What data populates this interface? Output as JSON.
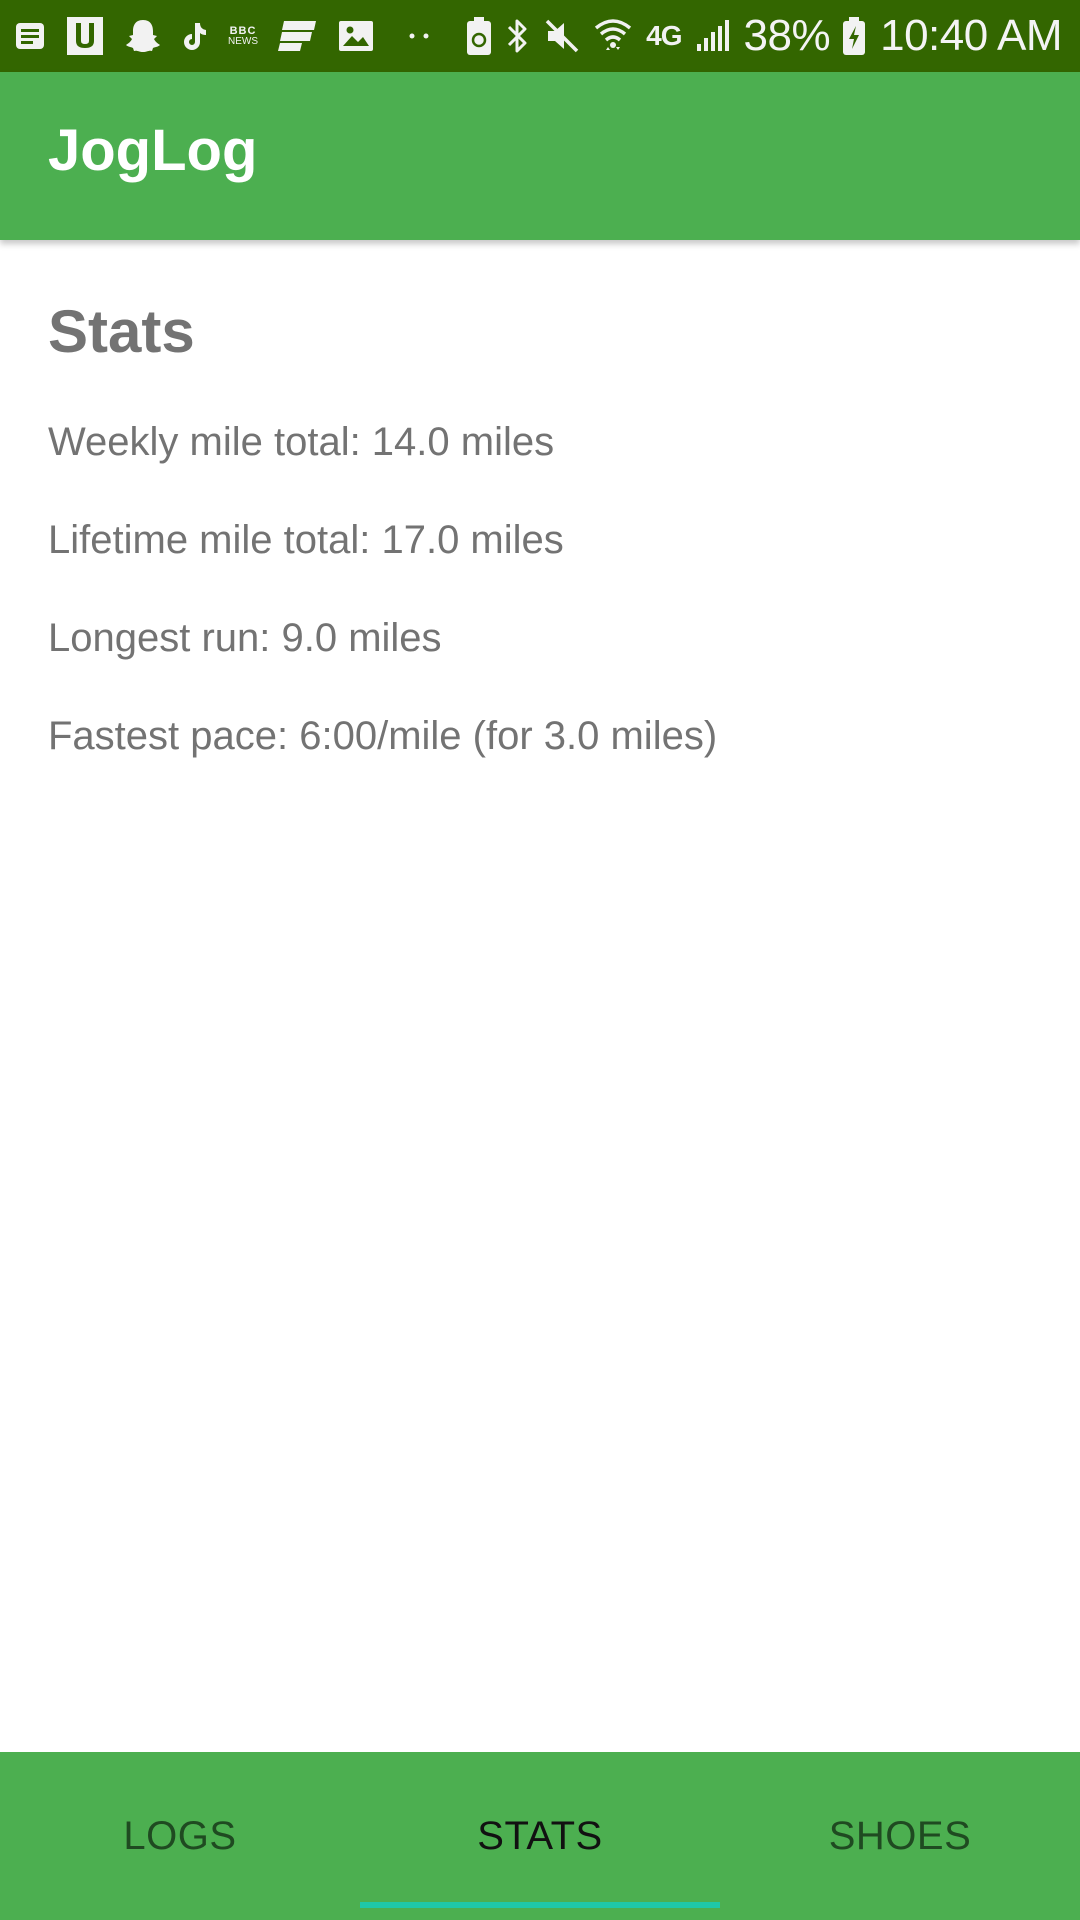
{
  "status_bar": {
    "left_icons": [
      "notes-icon",
      "u-app-icon",
      "snapchat-icon",
      "tiktok-icon",
      "bbc-news-icon",
      "flipboard-icon",
      "gallery-icon",
      "more-notifications-icon"
    ],
    "bbc_label": "BBC",
    "news_label": "NEWS",
    "network_label": "4G",
    "battery_percent": "38%",
    "time": "10:40 AM"
  },
  "app_bar": {
    "title": "JogLog",
    "color": "#4caf50"
  },
  "stats": {
    "heading": "Stats",
    "weekly_total": "Weekly mile total: 14.0 miles",
    "lifetime_total": "Lifetime mile total: 17.0 miles",
    "longest_run": "Longest run: 9.0 miles",
    "fastest_pace": "Fastest pace: 6:00/mile (for 3.0 miles)"
  },
  "tabs": [
    {
      "label": "LOGS",
      "active": false
    },
    {
      "label": "STATS",
      "active": true
    },
    {
      "label": "SHOES",
      "active": false
    }
  ],
  "colors": {
    "status_bar": "#336600",
    "primary": "#4caf50",
    "tab_indicator": "#1fc8a8",
    "text_gray": "#737373"
  }
}
